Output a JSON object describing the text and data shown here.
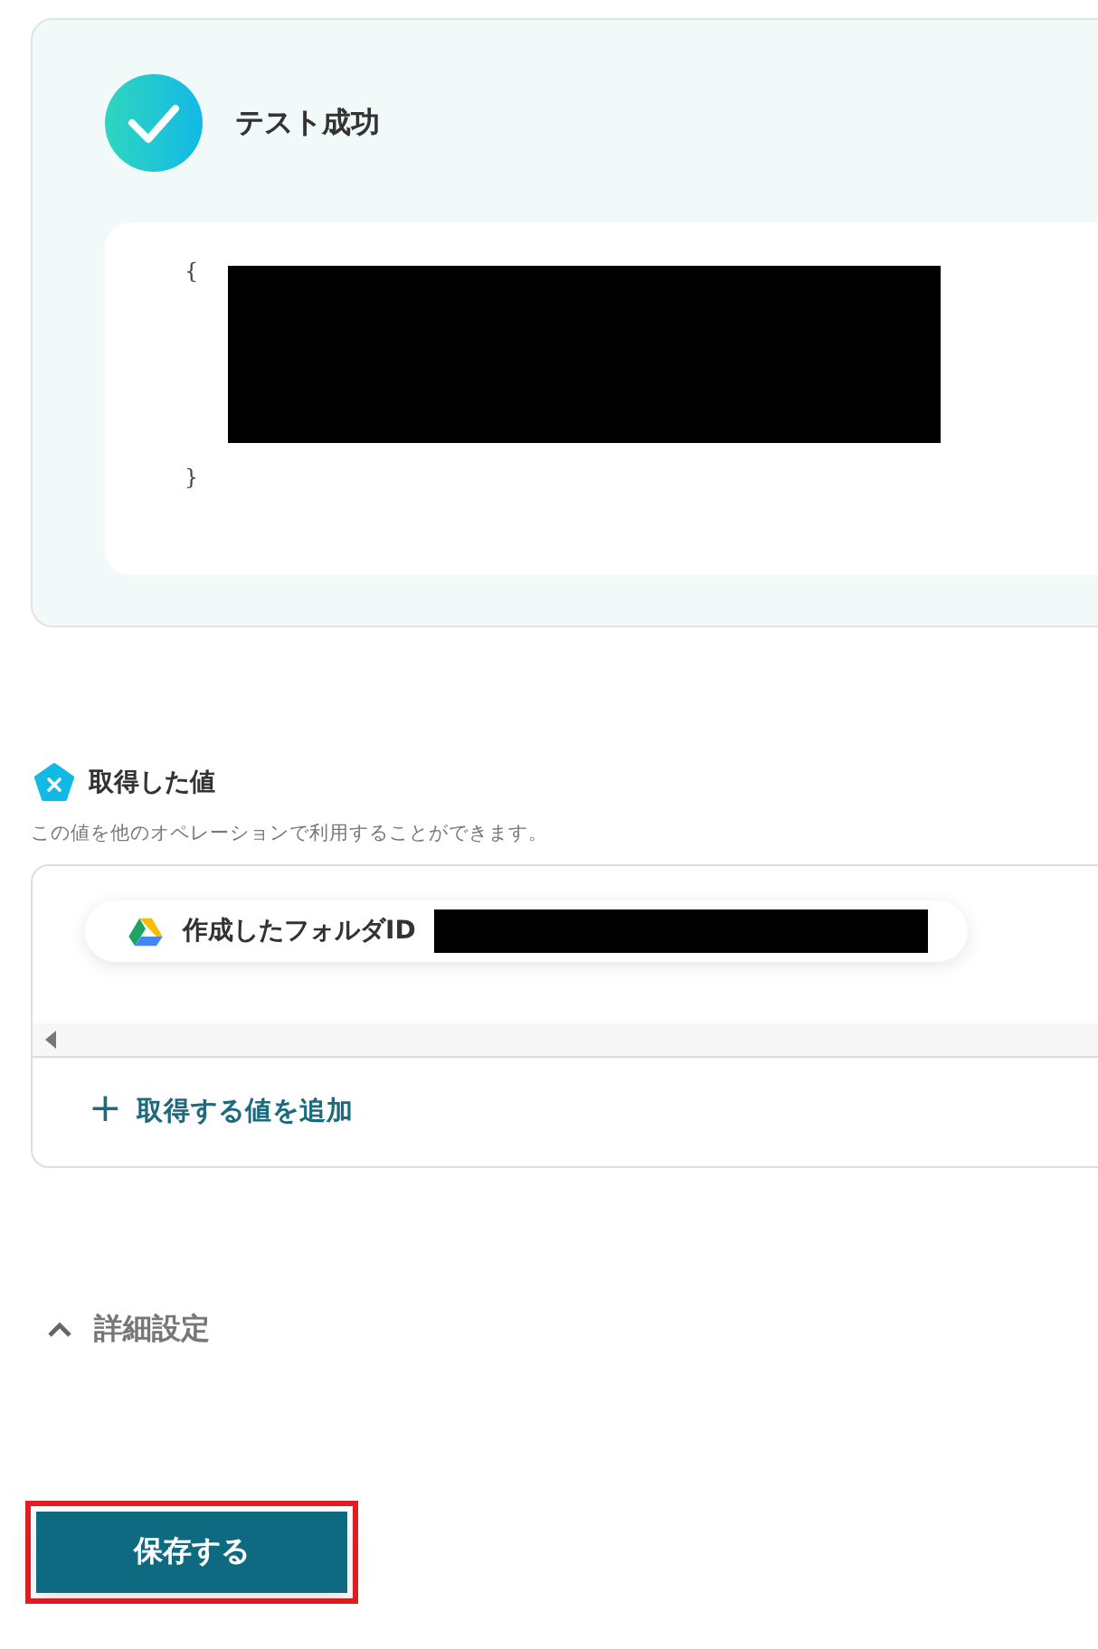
{
  "test_result": {
    "title": "テスト成功",
    "success": true,
    "open_brace": "{",
    "close_brace": "}",
    "redacted": true
  },
  "fetched_values": {
    "title": "取得した値",
    "description": "この値を他のオペレーションで利用することができます。",
    "items": [
      {
        "label": "作成したフォルダID",
        "redacted": true
      }
    ],
    "add_link": {
      "icon": "+",
      "label": "取得する値を追加"
    }
  },
  "advanced_settings": {
    "label": "詳細設定",
    "expanded": true
  },
  "save_button": {
    "label": "保存する",
    "highlighted": true
  }
}
